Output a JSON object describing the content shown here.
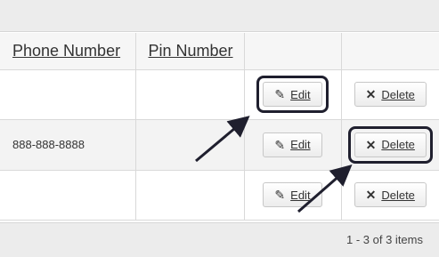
{
  "grid": {
    "columns": {
      "phone": "Phone Number",
      "pin": "Pin Number",
      "edit": "",
      "delete": ""
    },
    "rows": [
      {
        "phone": "",
        "pin": "",
        "edit_label": "Edit",
        "delete_label": "Delete"
      },
      {
        "phone": "888-888-8888",
        "pin": "",
        "edit_label": "Edit",
        "delete_label": "Delete"
      },
      {
        "phone": "",
        "pin": "",
        "edit_label": "Edit",
        "delete_label": "Delete"
      }
    ]
  },
  "icons": {
    "edit": "pencil-icon",
    "delete": "close-icon"
  },
  "footer": {
    "pager_info": "1 - 3 of 3 items"
  },
  "annotations": {
    "arrow_color": "#1f1f2e",
    "highlight_color": "#1f1f2e"
  }
}
